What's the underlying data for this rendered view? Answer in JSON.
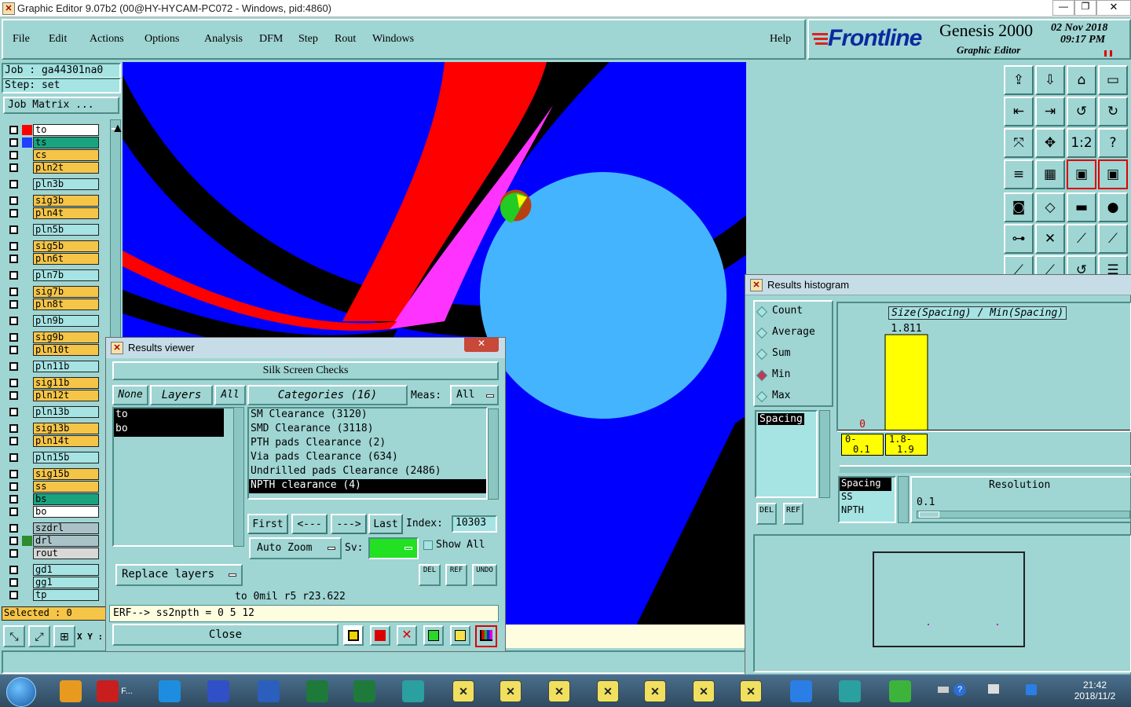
{
  "window": {
    "title": "Graphic Editor 9.07b2 (00@HY-HYCAM-PC072 - Windows, pid:4860)",
    "icon": "x-window-icon"
  },
  "menu": [
    "File",
    "Edit",
    "Actions",
    "Options",
    "Analysis",
    "DFM",
    "Step",
    "Rout",
    "Windows"
  ],
  "help": "Help",
  "brand": {
    "logo": "Frontline",
    "product": "Genesis 2000",
    "subtitle": "Graphic Editor",
    "date": "02 Nov 2018",
    "time": "09:17 PM"
  },
  "job": {
    "job_label": "Job : ga44301na0",
    "step_label": "Step: set",
    "matrix_button": "Job Matrix ..."
  },
  "layers": [
    {
      "name": "to",
      "bg": "#ffffff",
      "cb": "#ff0000"
    },
    {
      "name": "ts",
      "bg": "#1aa37f",
      "cb": "#2040ff"
    },
    {
      "name": "cs",
      "bg": "#f5c548",
      "cb": ""
    },
    {
      "name": "pln2t",
      "bg": "#f5c548",
      "cb": ""
    },
    {
      "name": "pln3b",
      "bg": "#a6e3e3",
      "cb": ""
    },
    {
      "name": "sig3b",
      "bg": "#f5c548",
      "cb": ""
    },
    {
      "name": "pln4t",
      "bg": "#f5c548",
      "cb": ""
    },
    {
      "name": "pln5b",
      "bg": "#a6e3e3",
      "cb": ""
    },
    {
      "name": "sig5b",
      "bg": "#f5c548",
      "cb": ""
    },
    {
      "name": "pln6t",
      "bg": "#f5c548",
      "cb": ""
    },
    {
      "name": "pln7b",
      "bg": "#a6e3e3",
      "cb": ""
    },
    {
      "name": "sig7b",
      "bg": "#f5c548",
      "cb": ""
    },
    {
      "name": "pln8t",
      "bg": "#f5c548",
      "cb": ""
    },
    {
      "name": "pln9b",
      "bg": "#a6e3e3",
      "cb": ""
    },
    {
      "name": "sig9b",
      "bg": "#f5c548",
      "cb": ""
    },
    {
      "name": "pln10t",
      "bg": "#f5c548",
      "cb": ""
    },
    {
      "name": "pln11b",
      "bg": "#a6e3e3",
      "cb": ""
    },
    {
      "name": "sig11b",
      "bg": "#f5c548",
      "cb": ""
    },
    {
      "name": "pln12t",
      "bg": "#f5c548",
      "cb": ""
    },
    {
      "name": "pln13b",
      "bg": "#a6e3e3",
      "cb": ""
    },
    {
      "name": "sig13b",
      "bg": "#f5c548",
      "cb": ""
    },
    {
      "name": "pln14t",
      "bg": "#f5c548",
      "cb": ""
    },
    {
      "name": "pln15b",
      "bg": "#a6e3e3",
      "cb": ""
    },
    {
      "name": "sig15b",
      "bg": "#f5c548",
      "cb": ""
    },
    {
      "name": "ss",
      "bg": "#f5c548",
      "cb": ""
    },
    {
      "name": "bs",
      "bg": "#1aa37f",
      "cb": ""
    },
    {
      "name": "bo",
      "bg": "#ffffff",
      "cb": ""
    },
    {
      "name": "szdrl",
      "bg": "#a9c2c7",
      "cb": ""
    },
    {
      "name": "drl",
      "bg": "#a9c2c7",
      "cb": "#2e8b2e"
    },
    {
      "name": "rout",
      "bg": "#d8d8d8",
      "cb": ""
    },
    {
      "name": "gd1",
      "bg": "#a6e3e3",
      "cb": ""
    },
    {
      "name": "gg1",
      "bg": "#a6e3e3",
      "cb": ""
    },
    {
      "name": "tp",
      "bg": "#a6e3e3",
      "cb": ""
    }
  ],
  "status": {
    "selected": "Selected : 0",
    "xy": "X Y :"
  },
  "results_viewer": {
    "title": "Results viewer",
    "header": "Silk Screen Checks",
    "none": "None",
    "layers": "Layers",
    "all": "All",
    "categories": "Categories (16)",
    "meas_label": "Meas:",
    "meas_value": "All",
    "layer_list": [
      "to",
      "bo"
    ],
    "category_items": [
      "SM Clearance (3120)",
      "SMD Clearance (3118)",
      "PTH pads Clearance (2)",
      "Via pads Clearance (634)",
      "Undrilled pads Clearance (2486)",
      "NPTH clearance (4)"
    ],
    "first": "First",
    "prev": "<---",
    "next": "--->",
    "last": "Last",
    "index_label": "Index:",
    "index_value": "10303",
    "auto_zoom": "Auto Zoom",
    "sv": "Sv:",
    "show_all": "Show All",
    "replace_layers": "Replace layers",
    "del": "DEL",
    "ref": "REF",
    "undo": "UNDO",
    "info": "to  0mil   r5   r23.622",
    "erf": "ERF--> ss2npth = 0 5 12",
    "close": "Close"
  },
  "histogram": {
    "title": "Results histogram",
    "modes": [
      "Count",
      "Average",
      "Sum",
      "Min",
      "Max"
    ],
    "selected_mode": "Min",
    "chart_title": "Size(Spacing) / Min(Spacing)",
    "list1": [
      "Spacing"
    ],
    "list2": [
      "Spacing",
      "SS",
      "NPTH"
    ],
    "resolution_label": "Resolution",
    "resolution_value": "0.1",
    "del": "DEL",
    "ref": "REF"
  },
  "chart_data": {
    "type": "bar",
    "title": "Size(Spacing) / Min(Spacing)",
    "categories": [
      "0-0.1",
      "1.8-1.9"
    ],
    "values": [
      0,
      1.811
    ],
    "data_labels": [
      "0",
      "1.811"
    ],
    "category_labels": [
      [
        "0-",
        "0.1"
      ],
      [
        "1.8-",
        "1.9"
      ]
    ],
    "colors": {
      "bar": "#ffff00",
      "zero_label": "#d00000"
    }
  },
  "taskbar": {
    "clock_time": "21:42",
    "clock_date": "2018/11/2",
    "ie_label": "F..."
  }
}
